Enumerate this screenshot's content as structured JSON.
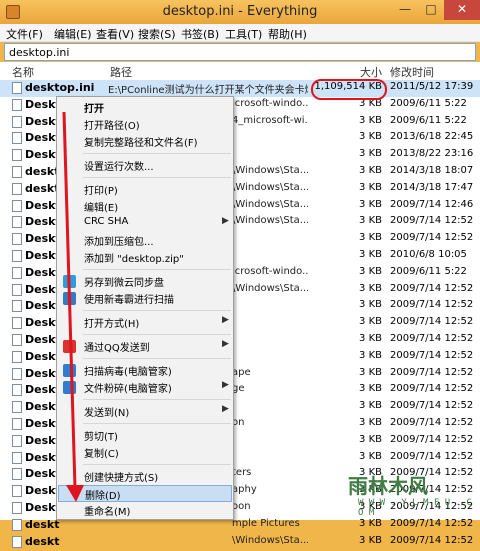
{
  "window": {
    "title": "desktop.ini - Everything",
    "min": "—",
    "max": "□",
    "close": "✕"
  },
  "menu": [
    "文件(F)",
    "编辑(E)",
    "查看(V)",
    "搜索(S)",
    "书签(B)",
    "工具(T)",
    "帮助(H)"
  ],
  "search": {
    "value": "desktop.ini"
  },
  "columns": {
    "name": "名称",
    "path": "路径",
    "size": "大小",
    "modified": "修改时间"
  },
  "rows": [
    {
      "name": "desktop.ini",
      "path": "E:\\PConline测试为什么打开某个文件夹会卡爆",
      "size": "1,109,514 KB",
      "date": "2011/5/12 17:39"
    },
    {
      "name": "Deskt",
      "path": "icrosoft-windo...",
      "size": "3 KB",
      "date": "2009/6/11 5:22"
    },
    {
      "name": "Deskt",
      "path": "4_microsoft-wi...",
      "size": "3 KB",
      "date": "2009/6/11 5:22"
    },
    {
      "name": "Deskt",
      "path": "",
      "size": "3 KB",
      "date": "2013/6/18 22:45"
    },
    {
      "name": "Deskt",
      "path": "",
      "size": "3 KB",
      "date": "2013/8/22 23:16"
    },
    {
      "name": "deskt",
      "path": "\\Windows\\Sta...",
      "size": "3 KB",
      "date": "2014/3/18 18:07"
    },
    {
      "name": "deskt",
      "path": "\\Windows\\Sta...",
      "size": "3 KB",
      "date": "2014/3/18 17:47"
    },
    {
      "name": "Deskt",
      "path": "\\Windows\\Sta...",
      "size": "3 KB",
      "date": "2009/7/14 12:46"
    },
    {
      "name": "Deskt",
      "path": "\\Windows\\Sta...",
      "size": "3 KB",
      "date": "2009/7/14 12:52"
    },
    {
      "name": "Deskt",
      "path": "",
      "size": "3 KB",
      "date": "2009/7/14 12:52"
    },
    {
      "name": "Deskt",
      "path": "",
      "size": "3 KB",
      "date": "2010/6/8 10:05"
    },
    {
      "name": "Deskt",
      "path": "icrosoft-windo...",
      "size": "3 KB",
      "date": "2009/6/11 5:22"
    },
    {
      "name": "Deskt",
      "path": "\\Windows\\Sta...",
      "size": "3 KB",
      "date": "2009/7/14 12:52"
    },
    {
      "name": "Deskt",
      "path": "",
      "size": "3 KB",
      "date": "2009/7/14 12:52"
    },
    {
      "name": "Deskt",
      "path": "",
      "size": "3 KB",
      "date": "2009/7/14 12:52"
    },
    {
      "name": "Deskt",
      "path": "",
      "size": "3 KB",
      "date": "2009/7/14 12:52"
    },
    {
      "name": "Deskt",
      "path": "",
      "size": "3 KB",
      "date": "2009/7/14 12:52"
    },
    {
      "name": "Deskt",
      "path": "ape",
      "size": "3 KB",
      "date": "2009/7/14 12:52"
    },
    {
      "name": "Deskt",
      "path": "ge",
      "size": "3 KB",
      "date": "2009/7/14 12:52"
    },
    {
      "name": "Deskt",
      "path": "",
      "size": "3 KB",
      "date": "2009/7/14 12:52"
    },
    {
      "name": "Deskt",
      "path": "on",
      "size": "3 KB",
      "date": "2009/7/14 12:52"
    },
    {
      "name": "Deskt",
      "path": "",
      "size": "3 KB",
      "date": "2009/7/14 12:52"
    },
    {
      "name": "Deskt",
      "path": "",
      "size": "3 KB",
      "date": "2009/7/14 12:52"
    },
    {
      "name": "Deskt",
      "path": "ters",
      "size": "3 KB",
      "date": "2009/7/14 12:52"
    },
    {
      "name": "Deskt",
      "path": "aphy",
      "size": "3 KB",
      "date": "2009/7/14 12:52"
    },
    {
      "name": "Deskt",
      "path": "oon",
      "size": "3 KB",
      "date": "2009/7/14 12:52"
    },
    {
      "name": "deskt",
      "path": "mple Pictures",
      "size": "3 KB",
      "date": "2009/7/14 12:52"
    },
    {
      "name": "deskt",
      "path": "\\Windows\\Sta...",
      "size": "3 KB",
      "date": "2009/7/14 12:52"
    }
  ],
  "context_menu": [
    {
      "label": "打开",
      "bold": true
    },
    {
      "label": "打开路径(O)"
    },
    {
      "label": "复制完整路径和文件名(F)"
    },
    {
      "sep": true
    },
    {
      "label": "设置运行次数..."
    },
    {
      "sep": true
    },
    {
      "label": "打印(P)"
    },
    {
      "label": "编辑(E)"
    },
    {
      "label": "CRC SHA",
      "sub": true
    },
    {
      "label": "添加到压缩包..."
    },
    {
      "label": "添加到 \"desktop.zip\""
    },
    {
      "sep": true
    },
    {
      "label": "另存到微云同步盘",
      "icon": "cloud-icon",
      "color": "#2f9bd9"
    },
    {
      "label": "使用新毒霸进行扫描",
      "icon": "shield-icon",
      "color": "#3b78c2"
    },
    {
      "sep": true
    },
    {
      "label": "打开方式(H)",
      "sub": true
    },
    {
      "sep": true
    },
    {
      "label": "通过QQ发送到",
      "sub": true,
      "icon": "qq-icon",
      "color": "#d9332f"
    },
    {
      "sep": true
    },
    {
      "label": "扫描病毒(电脑管家)",
      "icon": "guard-icon",
      "color": "#2f7dcb"
    },
    {
      "label": "文件粉碎(电脑管家)",
      "sub": true,
      "icon": "guard-icon",
      "color": "#2f7dcb"
    },
    {
      "sep": true
    },
    {
      "label": "发送到(N)",
      "sub": true
    },
    {
      "sep": true
    },
    {
      "label": "剪切(T)"
    },
    {
      "label": "复制(C)"
    },
    {
      "sep": true
    },
    {
      "label": "创建快捷方式(S)"
    },
    {
      "label": "删除(D)",
      "active": true
    },
    {
      "label": "重命名(M)"
    }
  ],
  "highlight_color": "#e0141e",
  "watermark": {
    "line1": "雨林木风",
    "line2": "W W W . Y L M F U . C O M"
  }
}
